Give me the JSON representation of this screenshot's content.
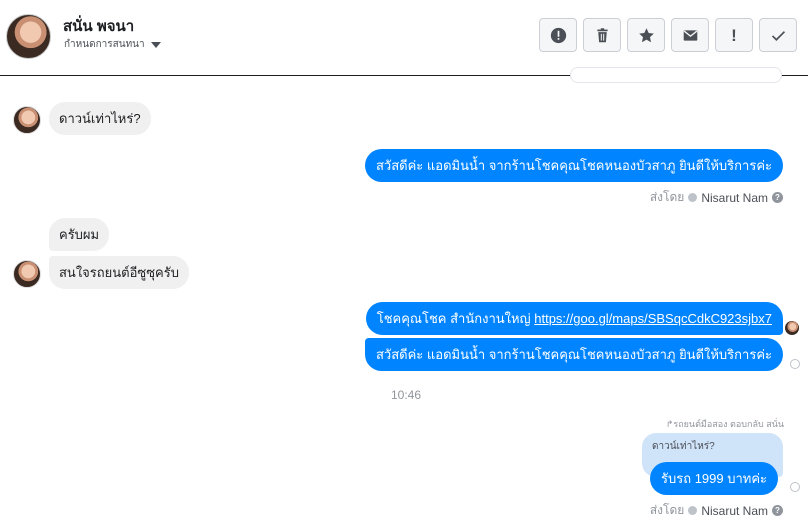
{
  "header": {
    "contact_name": "สนั่น พจนา",
    "manage_label": "กำหนดการสนทนา",
    "toolbar": [
      {
        "name": "report-button",
        "icon": "alert-circle-icon"
      },
      {
        "name": "delete-button",
        "icon": "trash-icon"
      },
      {
        "name": "star-button",
        "icon": "star-icon"
      },
      {
        "name": "mark-unread-button",
        "icon": "envelope-icon"
      },
      {
        "name": "spam-button",
        "icon": "exclamation-icon"
      },
      {
        "name": "done-button",
        "icon": "checkmark-icon"
      }
    ]
  },
  "messages": {
    "m1": "ดาวน์เท่าไหร่?",
    "m2": "สวัสดีค่ะ แอดมินน้ำ จากร้านโชคคุณโชคหนองบัวสาภู ยินดีให้บริการค่ะ",
    "m3": "ครับผม",
    "m4": "สนใจรถยนต์อีซูซุครับ",
    "m5_prefix": "โชคคุณโชค สำนักงานใหญ่ ",
    "m5_link": "https://goo.gl/maps/SBSqcCdkC923sjbx7",
    "m6": "สวัสดีค่ะ แอดมินน้ำ จากร้านโชคคุณโชคหนองบัวสาภู ยินดีให้บริการค่ะ",
    "quoted": "ดาวน์เท่าไหร่?",
    "m7": "รับรถ 1999 บาทค่ะ"
  },
  "sent_by": {
    "prefix": "ส่งโดย",
    "name": "Nisarut Nam",
    "help": "?"
  },
  "timestamp": "10:46",
  "reply_label": "↱รถยนต์มือสอง ตอบกลับ สนั่น",
  "colors": {
    "outgoing": "#0084ff",
    "incoming": "#f1f0f0"
  }
}
